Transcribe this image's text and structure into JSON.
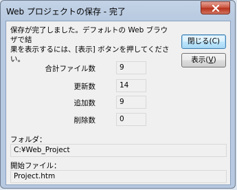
{
  "window": {
    "title": "Web プロジェクトの保存 - 完了"
  },
  "message": "保存が完了しました。デフォルトの Web ブラウザで結\n果を表示するには、[表示] ボタンを押してください。",
  "buttons": {
    "close_label": "閉じる(C)",
    "show_label_prefix": "表示(",
    "show_label_mnemonic": "V",
    "show_label_suffix": ")"
  },
  "stats": [
    {
      "label": "合計ファイル数",
      "value": "9"
    },
    {
      "label": "更新数",
      "value": "14"
    },
    {
      "label": "追加数",
      "value": "9"
    },
    {
      "label": "削除数",
      "value": "0"
    }
  ],
  "folder": {
    "label": "フォルダ：",
    "value": "C:¥Web_Project"
  },
  "start_file": {
    "label": "開始ファイル：",
    "value": "Project.htm"
  },
  "icons": {
    "close": "close-icon"
  },
  "colors": {
    "title_bar": "#c4d3e6",
    "close_button": "#c7503a",
    "default_button_border": "#3c7fb1"
  }
}
